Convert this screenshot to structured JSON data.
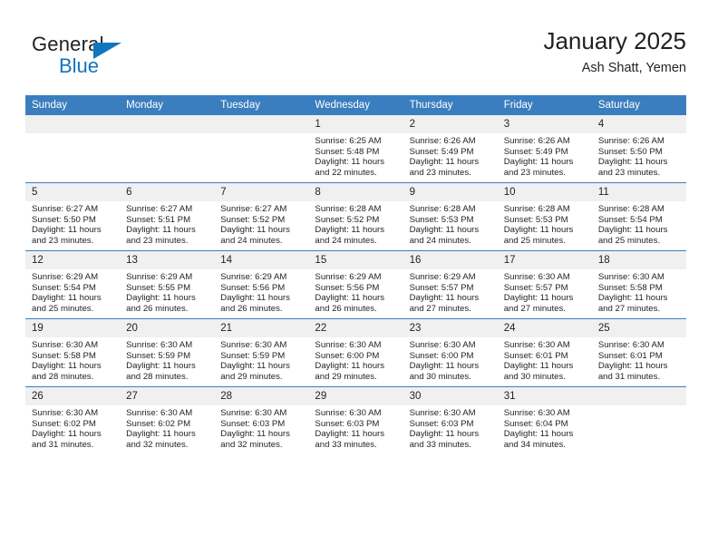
{
  "brand": {
    "name_top": "General",
    "name_bottom": "Blue",
    "accent_color": "#1175c0",
    "triangle_icon": "brand-triangle-icon"
  },
  "header": {
    "title": "January 2025",
    "subtitle": "Ash Shatt, Yemen"
  },
  "theme": {
    "header_row_bg": "#3b7ebf",
    "header_row_text": "#ffffff",
    "daynum_bg": "#f0f0f0",
    "cell_bg": "#ffffff",
    "text": "#231f20",
    "row_divider": "#3b7ebf"
  },
  "weekday_headers": [
    "Sunday",
    "Monday",
    "Tuesday",
    "Wednesday",
    "Thursday",
    "Friday",
    "Saturday"
  ],
  "weeks": [
    [
      {
        "day": "",
        "empty": true
      },
      {
        "day": "",
        "empty": true
      },
      {
        "day": "",
        "empty": true
      },
      {
        "day": "1",
        "sunrise": "Sunrise: 6:25 AM",
        "sunset": "Sunset: 5:48 PM",
        "daylight": "Daylight: 11 hours and 22 minutes."
      },
      {
        "day": "2",
        "sunrise": "Sunrise: 6:26 AM",
        "sunset": "Sunset: 5:49 PM",
        "daylight": "Daylight: 11 hours and 23 minutes."
      },
      {
        "day": "3",
        "sunrise": "Sunrise: 6:26 AM",
        "sunset": "Sunset: 5:49 PM",
        "daylight": "Daylight: 11 hours and 23 minutes."
      },
      {
        "day": "4",
        "sunrise": "Sunrise: 6:26 AM",
        "sunset": "Sunset: 5:50 PM",
        "daylight": "Daylight: 11 hours and 23 minutes."
      }
    ],
    [
      {
        "day": "5",
        "sunrise": "Sunrise: 6:27 AM",
        "sunset": "Sunset: 5:50 PM",
        "daylight": "Daylight: 11 hours and 23 minutes."
      },
      {
        "day": "6",
        "sunrise": "Sunrise: 6:27 AM",
        "sunset": "Sunset: 5:51 PM",
        "daylight": "Daylight: 11 hours and 23 minutes."
      },
      {
        "day": "7",
        "sunrise": "Sunrise: 6:27 AM",
        "sunset": "Sunset: 5:52 PM",
        "daylight": "Daylight: 11 hours and 24 minutes."
      },
      {
        "day": "8",
        "sunrise": "Sunrise: 6:28 AM",
        "sunset": "Sunset: 5:52 PM",
        "daylight": "Daylight: 11 hours and 24 minutes."
      },
      {
        "day": "9",
        "sunrise": "Sunrise: 6:28 AM",
        "sunset": "Sunset: 5:53 PM",
        "daylight": "Daylight: 11 hours and 24 minutes."
      },
      {
        "day": "10",
        "sunrise": "Sunrise: 6:28 AM",
        "sunset": "Sunset: 5:53 PM",
        "daylight": "Daylight: 11 hours and 25 minutes."
      },
      {
        "day": "11",
        "sunrise": "Sunrise: 6:28 AM",
        "sunset": "Sunset: 5:54 PM",
        "daylight": "Daylight: 11 hours and 25 minutes."
      }
    ],
    [
      {
        "day": "12",
        "sunrise": "Sunrise: 6:29 AM",
        "sunset": "Sunset: 5:54 PM",
        "daylight": "Daylight: 11 hours and 25 minutes."
      },
      {
        "day": "13",
        "sunrise": "Sunrise: 6:29 AM",
        "sunset": "Sunset: 5:55 PM",
        "daylight": "Daylight: 11 hours and 26 minutes."
      },
      {
        "day": "14",
        "sunrise": "Sunrise: 6:29 AM",
        "sunset": "Sunset: 5:56 PM",
        "daylight": "Daylight: 11 hours and 26 minutes."
      },
      {
        "day": "15",
        "sunrise": "Sunrise: 6:29 AM",
        "sunset": "Sunset: 5:56 PM",
        "daylight": "Daylight: 11 hours and 26 minutes."
      },
      {
        "day": "16",
        "sunrise": "Sunrise: 6:29 AM",
        "sunset": "Sunset: 5:57 PM",
        "daylight": "Daylight: 11 hours and 27 minutes."
      },
      {
        "day": "17",
        "sunrise": "Sunrise: 6:30 AM",
        "sunset": "Sunset: 5:57 PM",
        "daylight": "Daylight: 11 hours and 27 minutes."
      },
      {
        "day": "18",
        "sunrise": "Sunrise: 6:30 AM",
        "sunset": "Sunset: 5:58 PM",
        "daylight": "Daylight: 11 hours and 27 minutes."
      }
    ],
    [
      {
        "day": "19",
        "sunrise": "Sunrise: 6:30 AM",
        "sunset": "Sunset: 5:58 PM",
        "daylight": "Daylight: 11 hours and 28 minutes."
      },
      {
        "day": "20",
        "sunrise": "Sunrise: 6:30 AM",
        "sunset": "Sunset: 5:59 PM",
        "daylight": "Daylight: 11 hours and 28 minutes."
      },
      {
        "day": "21",
        "sunrise": "Sunrise: 6:30 AM",
        "sunset": "Sunset: 5:59 PM",
        "daylight": "Daylight: 11 hours and 29 minutes."
      },
      {
        "day": "22",
        "sunrise": "Sunrise: 6:30 AM",
        "sunset": "Sunset: 6:00 PM",
        "daylight": "Daylight: 11 hours and 29 minutes."
      },
      {
        "day": "23",
        "sunrise": "Sunrise: 6:30 AM",
        "sunset": "Sunset: 6:00 PM",
        "daylight": "Daylight: 11 hours and 30 minutes."
      },
      {
        "day": "24",
        "sunrise": "Sunrise: 6:30 AM",
        "sunset": "Sunset: 6:01 PM",
        "daylight": "Daylight: 11 hours and 30 minutes."
      },
      {
        "day": "25",
        "sunrise": "Sunrise: 6:30 AM",
        "sunset": "Sunset: 6:01 PM",
        "daylight": "Daylight: 11 hours and 31 minutes."
      }
    ],
    [
      {
        "day": "26",
        "sunrise": "Sunrise: 6:30 AM",
        "sunset": "Sunset: 6:02 PM",
        "daylight": "Daylight: 11 hours and 31 minutes."
      },
      {
        "day": "27",
        "sunrise": "Sunrise: 6:30 AM",
        "sunset": "Sunset: 6:02 PM",
        "daylight": "Daylight: 11 hours and 32 minutes."
      },
      {
        "day": "28",
        "sunrise": "Sunrise: 6:30 AM",
        "sunset": "Sunset: 6:03 PM",
        "daylight": "Daylight: 11 hours and 32 minutes."
      },
      {
        "day": "29",
        "sunrise": "Sunrise: 6:30 AM",
        "sunset": "Sunset: 6:03 PM",
        "daylight": "Daylight: 11 hours and 33 minutes."
      },
      {
        "day": "30",
        "sunrise": "Sunrise: 6:30 AM",
        "sunset": "Sunset: 6:03 PM",
        "daylight": "Daylight: 11 hours and 33 minutes."
      },
      {
        "day": "31",
        "sunrise": "Sunrise: 6:30 AM",
        "sunset": "Sunset: 6:04 PM",
        "daylight": "Daylight: 11 hours and 34 minutes."
      },
      {
        "day": "",
        "empty": true
      }
    ]
  ]
}
